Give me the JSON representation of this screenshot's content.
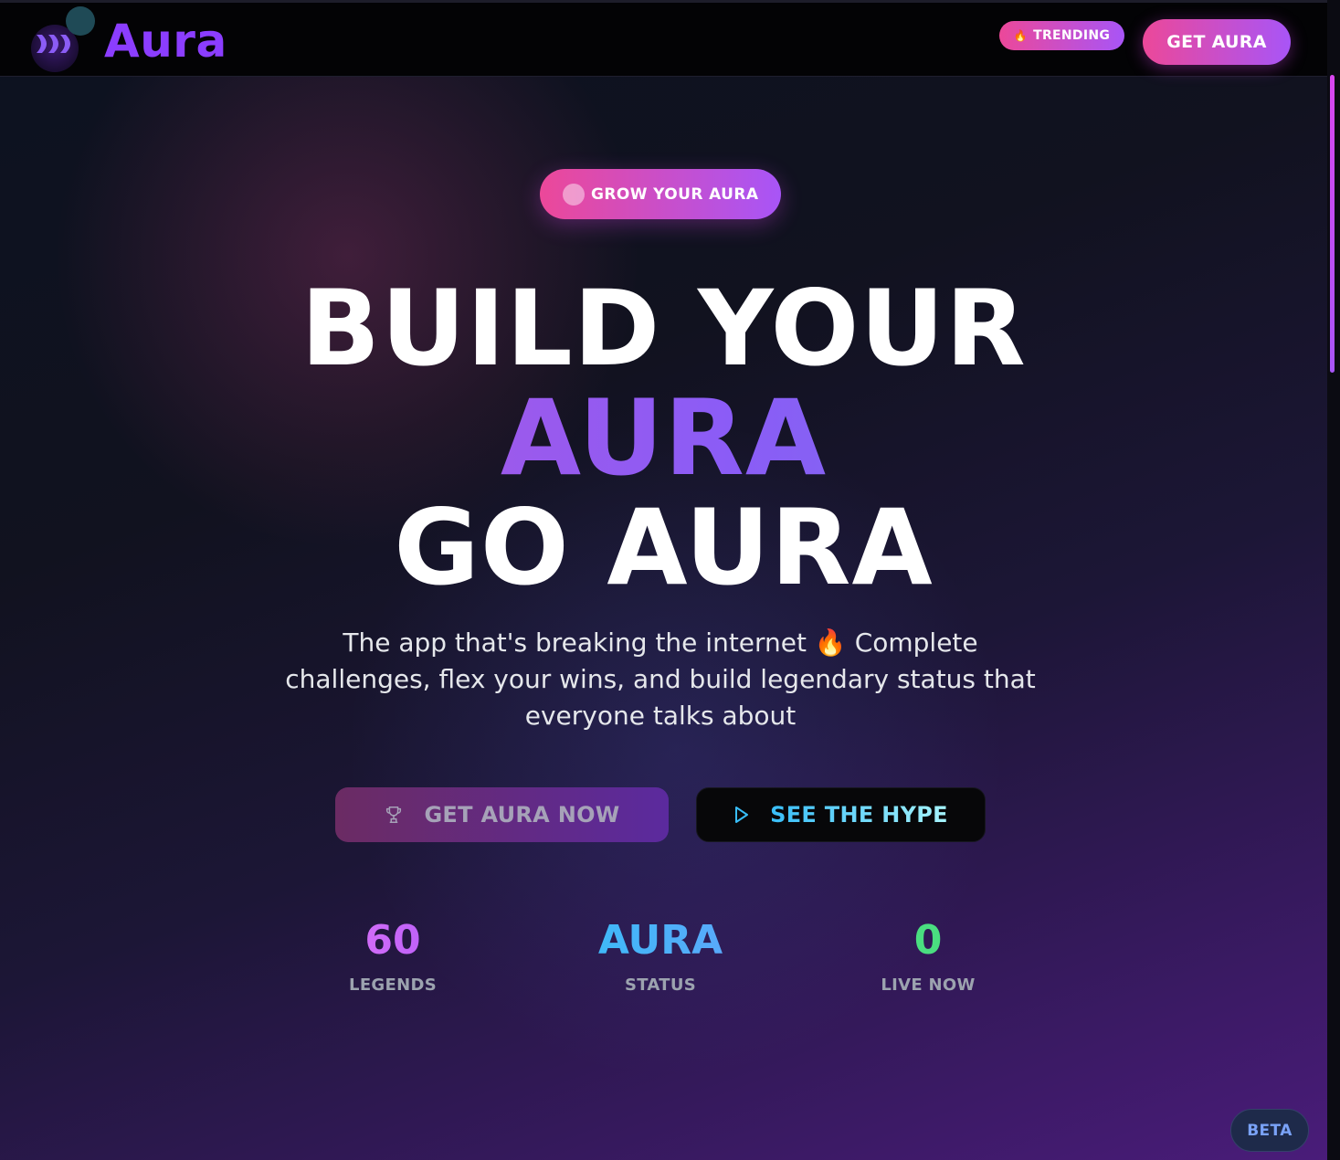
{
  "header": {
    "logo_text": "Aura",
    "trending_label": "TRENDING",
    "get_aura_label": "GET AURA"
  },
  "hero": {
    "badge_label": "GROW YOUR AURA",
    "headline_line1": "BUILD YOUR",
    "headline_line2": "AURA",
    "headline_line3": "GO AURA",
    "subtext_part1": "The app that's breaking the internet",
    "subtext_emoji": "🔥",
    "subtext_part2": "Complete challenges, flex your wins, and build legendary status that everyone talks about",
    "cta_primary_label": "GET AURA NOW",
    "cta_secondary_label": "SEE THE HYPE"
  },
  "stats": [
    {
      "value": "60",
      "label": "LEGENDS"
    },
    {
      "value": "AURA",
      "label": "STATUS"
    },
    {
      "value": "0",
      "label": "LIVE NOW"
    }
  ],
  "beta_label": "BETA",
  "icons": {
    "logo": "chevrons-logo-icon",
    "trending": "flame-icon",
    "cta_primary": "trophy-icon",
    "cta_secondary": "play-icon"
  },
  "colors": {
    "brand_purple": "#8b3dff",
    "pink": "#ec4899",
    "violet": "#a855f7",
    "cyan": "#38bdf8",
    "green": "#4ade80"
  }
}
